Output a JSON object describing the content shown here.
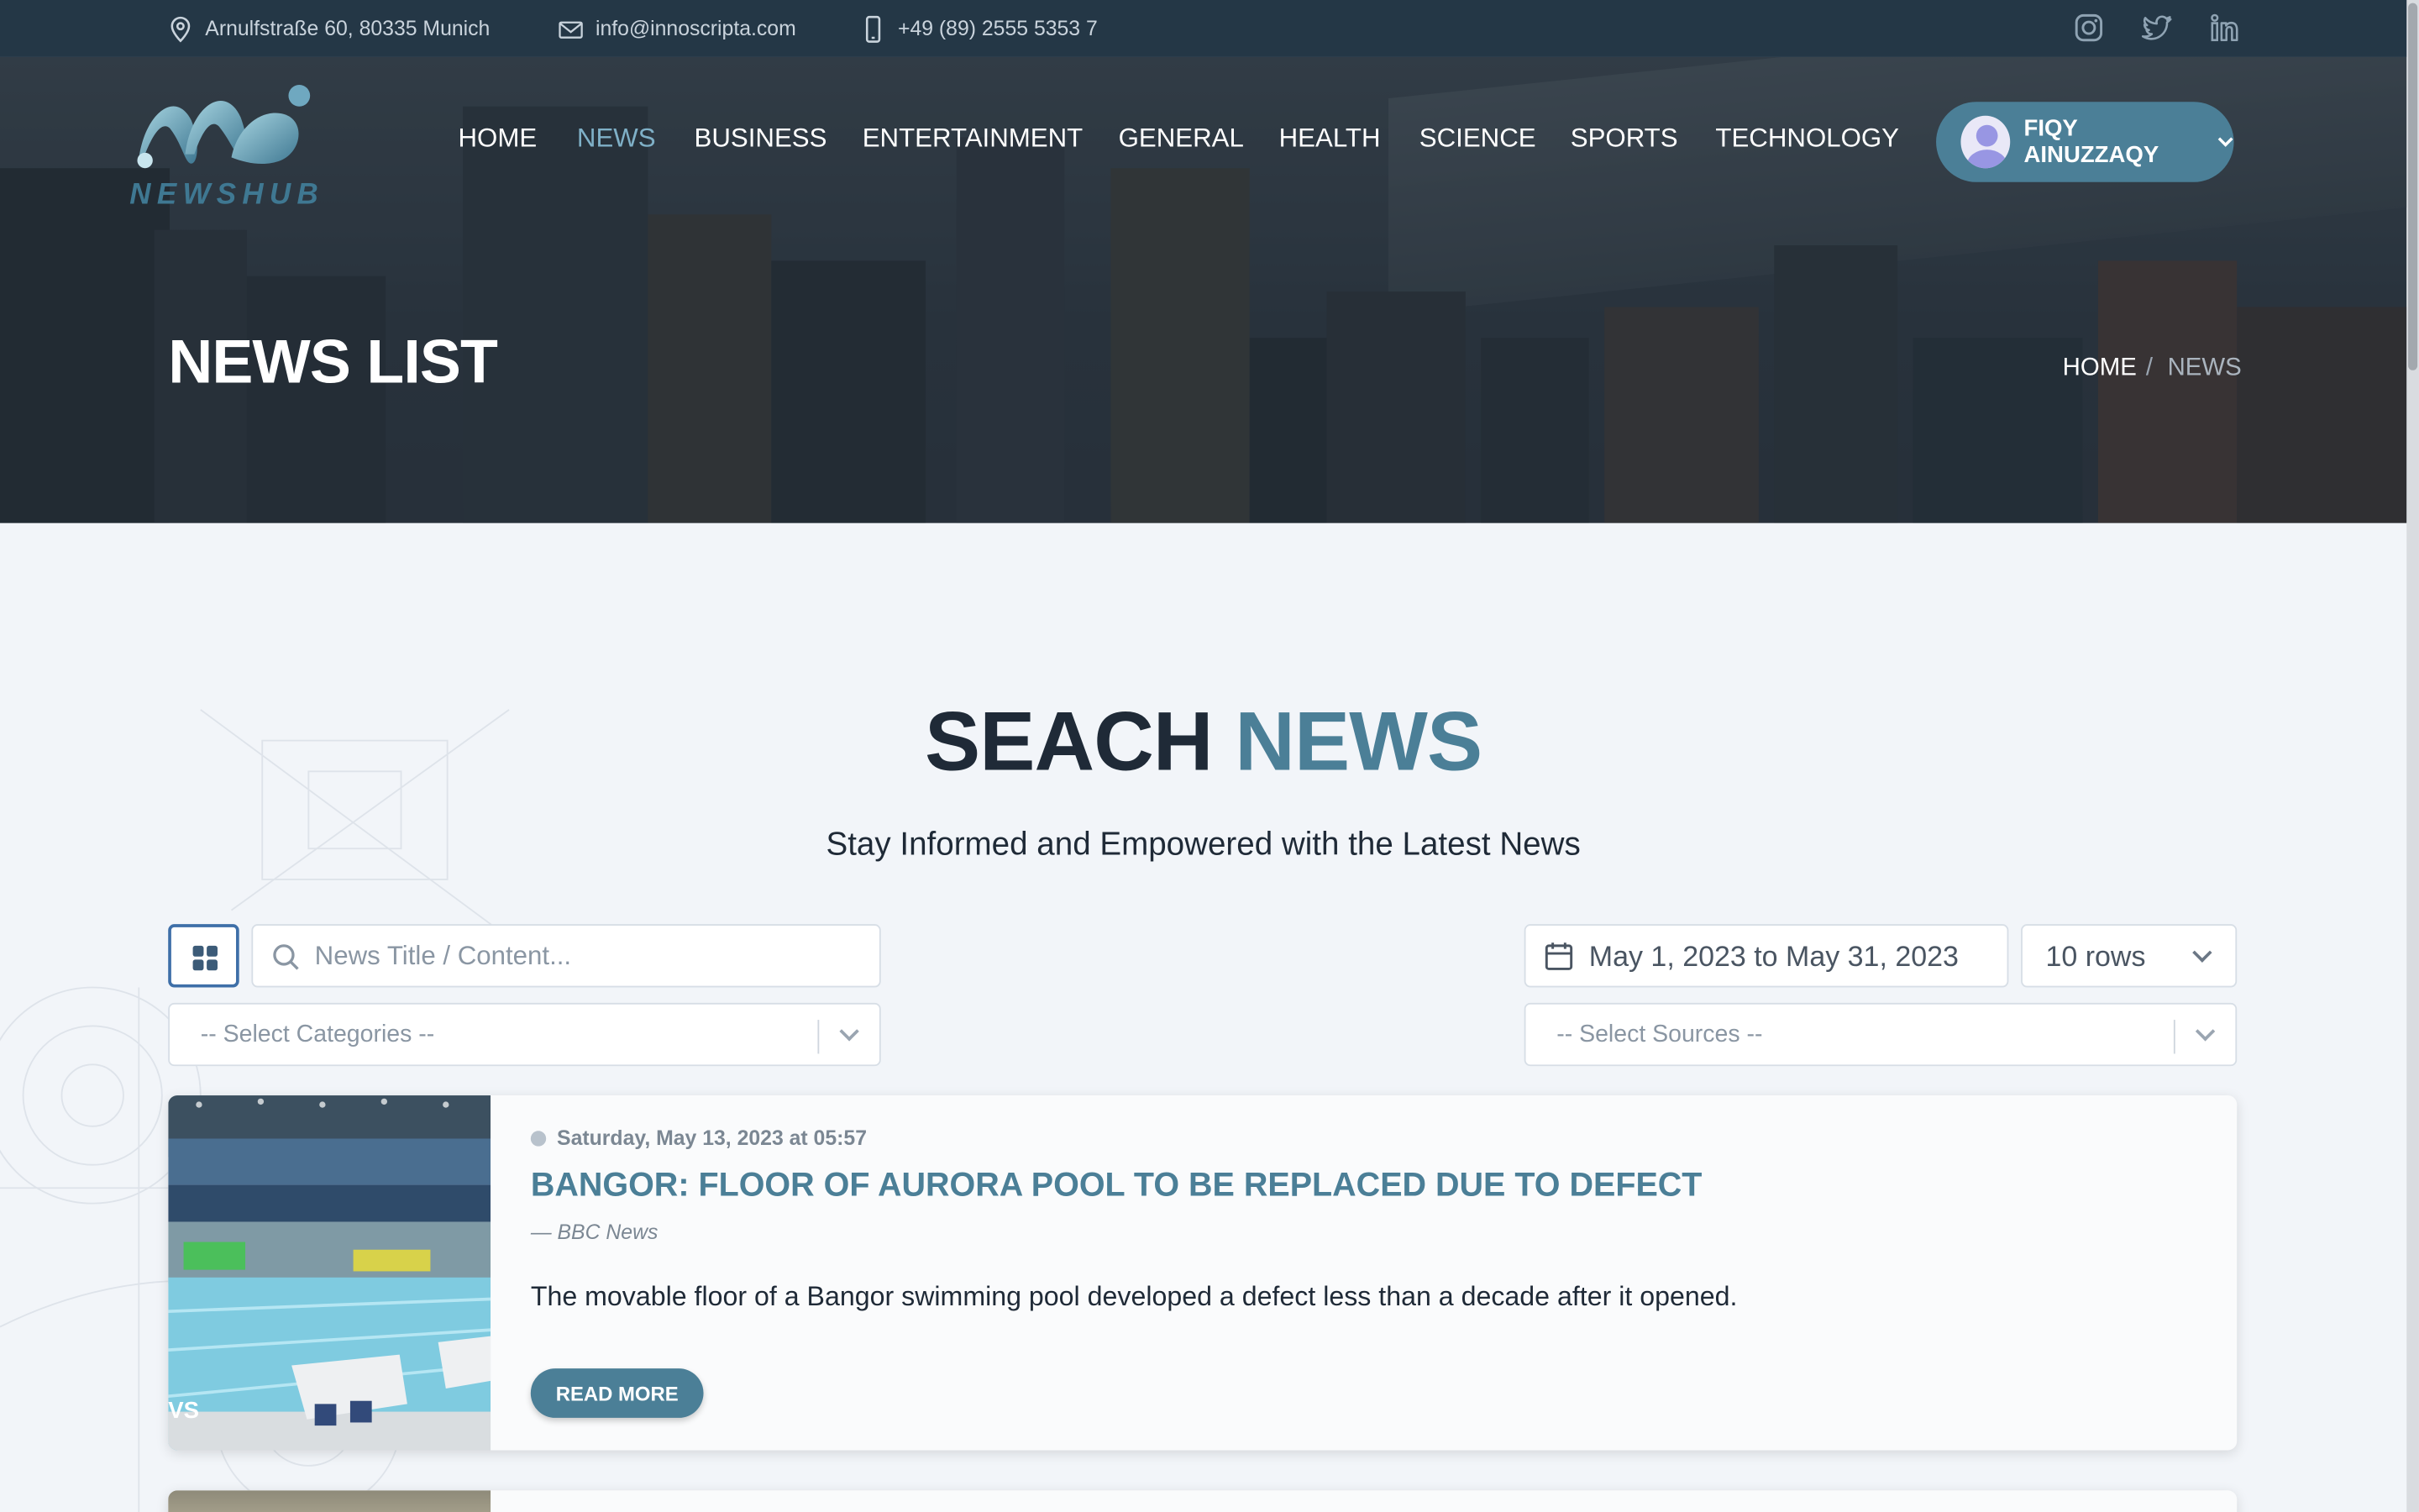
{
  "topbar": {
    "address": "Arnulfstraße 60, 80335 Munich",
    "email": "info@innoscripta.com",
    "phone": "+49 (89) 2555 5353 7",
    "social_icons": [
      "instagram-icon",
      "twitter-icon",
      "linkedin-icon"
    ]
  },
  "brand": {
    "name": "NEWSHUB"
  },
  "nav": {
    "items": [
      {
        "label": "HOME",
        "active": false
      },
      {
        "label": "NEWS",
        "active": true
      },
      {
        "label": "BUSINESS",
        "active": false
      },
      {
        "label": "ENTERTAINMENT",
        "active": false
      },
      {
        "label": "GENERAL",
        "active": false
      },
      {
        "label": "HEALTH",
        "active": false
      },
      {
        "label": "SCIENCE",
        "active": false
      },
      {
        "label": "SPORTS",
        "active": false
      },
      {
        "label": "TECHNOLOGY",
        "active": false
      }
    ],
    "user": {
      "name": "FIQY AINUZZAQY"
    }
  },
  "hero": {
    "title": "NEWS LIST",
    "breadcrumb": {
      "home": "HOME",
      "separator": "/",
      "current": "NEWS"
    }
  },
  "search": {
    "heading_main": "SEACH",
    "heading_accent": "NEWS",
    "subheading": "Stay Informed and Empowered with the Latest News",
    "query_placeholder": "News Title / Content...",
    "categories_placeholder": "-- Select Categories --",
    "sources_placeholder": "-- Select Sources --",
    "date_range": "May 1, 2023 to May 31, 2023",
    "rows": "10 rows"
  },
  "articles": [
    {
      "date": "Saturday, May 13, 2023 at 05:57",
      "title": "BANGOR: FLOOR OF AURORA POOL TO BE REPLACED DUE TO DEFECT",
      "source": "— BBC News",
      "description": "The movable floor of a Bangor swimming pool developed a defect less than a decade after it opened.",
      "thumb_caption": "VS",
      "cta": "READ MORE"
    }
  ],
  "colors": {
    "accent": "#4b7f97",
    "topbar": "#243746",
    "heading": "#1f2a37",
    "background": "#f2f5f9"
  }
}
